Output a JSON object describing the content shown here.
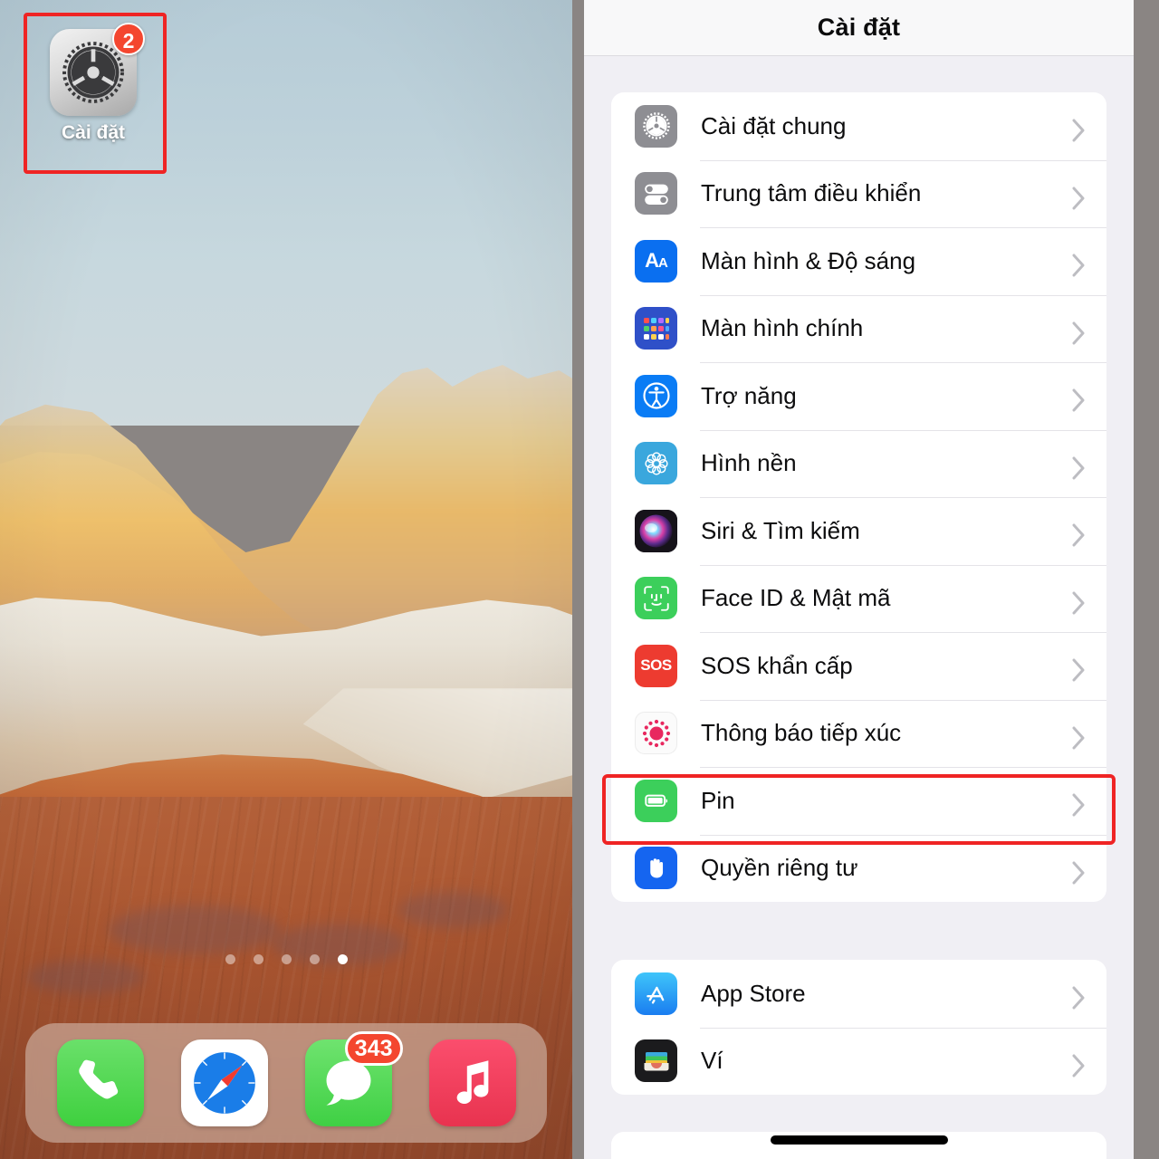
{
  "home_screen": {
    "app": {
      "name": "settings-app",
      "label": "Cài đặt",
      "badge_count": "2",
      "icon": "gear-icon",
      "highlighted": true,
      "highlight_color": "#ef2424"
    },
    "page_dots": {
      "count": 5,
      "active_index": 4
    },
    "dock": {
      "items": [
        {
          "name": "phone",
          "icon": "phone-icon",
          "badge": ""
        },
        {
          "name": "safari",
          "icon": "compass-icon",
          "badge": ""
        },
        {
          "name": "messages",
          "icon": "speech-bubble-icon",
          "badge": "343"
        },
        {
          "name": "music",
          "icon": "music-note-icon",
          "badge": ""
        }
      ]
    }
  },
  "settings": {
    "nav": {
      "title": "Cài đặt"
    },
    "groups": [
      {
        "id": "main-group",
        "rows": [
          {
            "label": "Cài đặt chung",
            "icon": "gear-icon",
            "icon_style": "gray"
          },
          {
            "label": "Trung tâm điều khiển",
            "icon": "toggles-icon",
            "icon_style": "gray"
          },
          {
            "label": "Màn hình & Độ sáng",
            "icon": "aa-icon",
            "icon_style": "blue"
          },
          {
            "label": "Màn hình chính",
            "icon": "app-grid-icon",
            "icon_style": "indigo"
          },
          {
            "label": "Trợ năng",
            "icon": "accessibility-icon",
            "icon_style": "blue"
          },
          {
            "label": "Hình nền",
            "icon": "flower-icon",
            "icon_style": "lightblue"
          },
          {
            "label": "Siri & Tìm kiếm",
            "icon": "siri-icon",
            "icon_style": "dark"
          },
          {
            "label": "Face ID & Mật mã",
            "icon": "faceid-icon",
            "icon_style": "green"
          },
          {
            "label": "SOS khẩn cấp",
            "icon": "sos-icon",
            "icon_style": "red"
          },
          {
            "label": "Thông báo tiếp xúc",
            "icon": "exposure-icon",
            "icon_style": "white"
          },
          {
            "label": "Pin",
            "icon": "battery-icon",
            "icon_style": "green",
            "highlighted": true
          },
          {
            "label": "Quyền riêng tư",
            "icon": "hand-icon",
            "icon_style": "blue"
          }
        ]
      },
      {
        "id": "store-group",
        "rows": [
          {
            "label": "App Store",
            "icon": "appstore-icon",
            "icon_style": "blue"
          },
          {
            "label": "Ví",
            "icon": "wallet-icon",
            "icon_style": "black"
          }
        ]
      }
    ],
    "highlight_color": "#ef2424",
    "accent_color": "#007aff"
  }
}
